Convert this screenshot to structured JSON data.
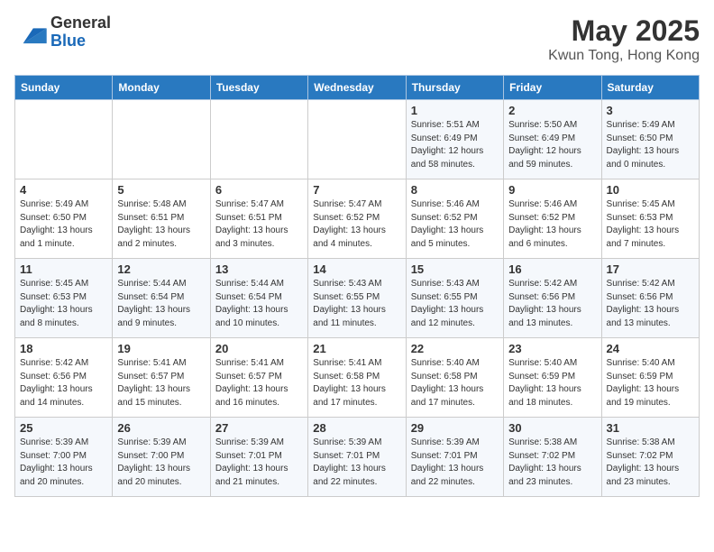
{
  "header": {
    "logo_general": "General",
    "logo_blue": "Blue",
    "month_year": "May 2025",
    "location": "Kwun Tong, Hong Kong"
  },
  "weekdays": [
    "Sunday",
    "Monday",
    "Tuesday",
    "Wednesday",
    "Thursday",
    "Friday",
    "Saturday"
  ],
  "weeks": [
    [
      {
        "day": "",
        "info": ""
      },
      {
        "day": "",
        "info": ""
      },
      {
        "day": "",
        "info": ""
      },
      {
        "day": "",
        "info": ""
      },
      {
        "day": "1",
        "info": "Sunrise: 5:51 AM\nSunset: 6:49 PM\nDaylight: 12 hours\nand 58 minutes."
      },
      {
        "day": "2",
        "info": "Sunrise: 5:50 AM\nSunset: 6:49 PM\nDaylight: 12 hours\nand 59 minutes."
      },
      {
        "day": "3",
        "info": "Sunrise: 5:49 AM\nSunset: 6:50 PM\nDaylight: 13 hours\nand 0 minutes."
      }
    ],
    [
      {
        "day": "4",
        "info": "Sunrise: 5:49 AM\nSunset: 6:50 PM\nDaylight: 13 hours\nand 1 minute."
      },
      {
        "day": "5",
        "info": "Sunrise: 5:48 AM\nSunset: 6:51 PM\nDaylight: 13 hours\nand 2 minutes."
      },
      {
        "day": "6",
        "info": "Sunrise: 5:47 AM\nSunset: 6:51 PM\nDaylight: 13 hours\nand 3 minutes."
      },
      {
        "day": "7",
        "info": "Sunrise: 5:47 AM\nSunset: 6:52 PM\nDaylight: 13 hours\nand 4 minutes."
      },
      {
        "day": "8",
        "info": "Sunrise: 5:46 AM\nSunset: 6:52 PM\nDaylight: 13 hours\nand 5 minutes."
      },
      {
        "day": "9",
        "info": "Sunrise: 5:46 AM\nSunset: 6:52 PM\nDaylight: 13 hours\nand 6 minutes."
      },
      {
        "day": "10",
        "info": "Sunrise: 5:45 AM\nSunset: 6:53 PM\nDaylight: 13 hours\nand 7 minutes."
      }
    ],
    [
      {
        "day": "11",
        "info": "Sunrise: 5:45 AM\nSunset: 6:53 PM\nDaylight: 13 hours\nand 8 minutes."
      },
      {
        "day": "12",
        "info": "Sunrise: 5:44 AM\nSunset: 6:54 PM\nDaylight: 13 hours\nand 9 minutes."
      },
      {
        "day": "13",
        "info": "Sunrise: 5:44 AM\nSunset: 6:54 PM\nDaylight: 13 hours\nand 10 minutes."
      },
      {
        "day": "14",
        "info": "Sunrise: 5:43 AM\nSunset: 6:55 PM\nDaylight: 13 hours\nand 11 minutes."
      },
      {
        "day": "15",
        "info": "Sunrise: 5:43 AM\nSunset: 6:55 PM\nDaylight: 13 hours\nand 12 minutes."
      },
      {
        "day": "16",
        "info": "Sunrise: 5:42 AM\nSunset: 6:56 PM\nDaylight: 13 hours\nand 13 minutes."
      },
      {
        "day": "17",
        "info": "Sunrise: 5:42 AM\nSunset: 6:56 PM\nDaylight: 13 hours\nand 13 minutes."
      }
    ],
    [
      {
        "day": "18",
        "info": "Sunrise: 5:42 AM\nSunset: 6:56 PM\nDaylight: 13 hours\nand 14 minutes."
      },
      {
        "day": "19",
        "info": "Sunrise: 5:41 AM\nSunset: 6:57 PM\nDaylight: 13 hours\nand 15 minutes."
      },
      {
        "day": "20",
        "info": "Sunrise: 5:41 AM\nSunset: 6:57 PM\nDaylight: 13 hours\nand 16 minutes."
      },
      {
        "day": "21",
        "info": "Sunrise: 5:41 AM\nSunset: 6:58 PM\nDaylight: 13 hours\nand 17 minutes."
      },
      {
        "day": "22",
        "info": "Sunrise: 5:40 AM\nSunset: 6:58 PM\nDaylight: 13 hours\nand 17 minutes."
      },
      {
        "day": "23",
        "info": "Sunrise: 5:40 AM\nSunset: 6:59 PM\nDaylight: 13 hours\nand 18 minutes."
      },
      {
        "day": "24",
        "info": "Sunrise: 5:40 AM\nSunset: 6:59 PM\nDaylight: 13 hours\nand 19 minutes."
      }
    ],
    [
      {
        "day": "25",
        "info": "Sunrise: 5:39 AM\nSunset: 7:00 PM\nDaylight: 13 hours\nand 20 minutes."
      },
      {
        "day": "26",
        "info": "Sunrise: 5:39 AM\nSunset: 7:00 PM\nDaylight: 13 hours\nand 20 minutes."
      },
      {
        "day": "27",
        "info": "Sunrise: 5:39 AM\nSunset: 7:01 PM\nDaylight: 13 hours\nand 21 minutes."
      },
      {
        "day": "28",
        "info": "Sunrise: 5:39 AM\nSunset: 7:01 PM\nDaylight: 13 hours\nand 22 minutes."
      },
      {
        "day": "29",
        "info": "Sunrise: 5:39 AM\nSunset: 7:01 PM\nDaylight: 13 hours\nand 22 minutes."
      },
      {
        "day": "30",
        "info": "Sunrise: 5:38 AM\nSunset: 7:02 PM\nDaylight: 13 hours\nand 23 minutes."
      },
      {
        "day": "31",
        "info": "Sunrise: 5:38 AM\nSunset: 7:02 PM\nDaylight: 13 hours\nand 23 minutes."
      }
    ]
  ]
}
